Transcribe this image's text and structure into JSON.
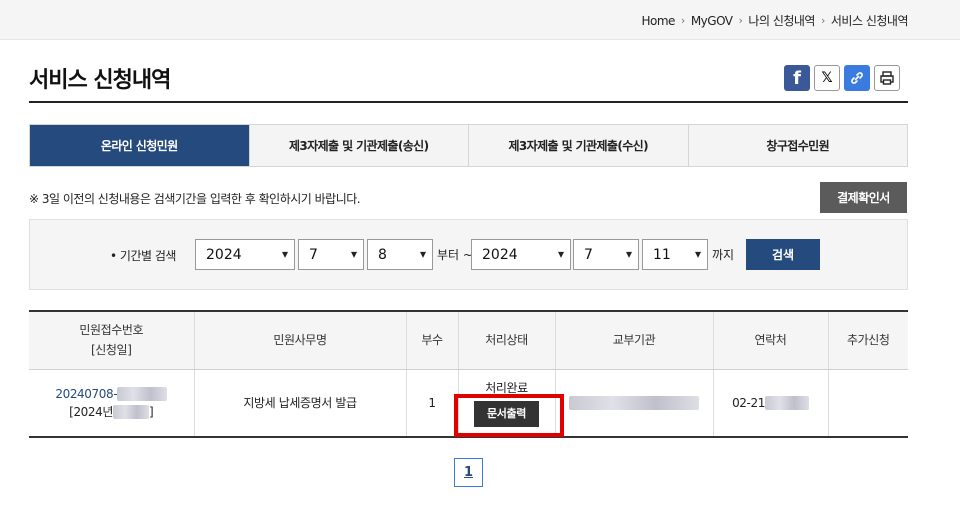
{
  "breadcrumb": [
    "Home",
    "MyGOV",
    "나의 신청내역",
    "서비스 신청내역"
  ],
  "page_title": "서비스 신청내역",
  "share_icons": [
    "facebook-icon",
    "x-icon",
    "link-icon",
    "print-icon"
  ],
  "tabs": [
    {
      "label": "온라인 신청민원",
      "active": true
    },
    {
      "label": "제3자제출 및 기관제출(송신)",
      "active": false
    },
    {
      "label": "제3자제출 및 기관제출(수신)",
      "active": false
    },
    {
      "label": "창구접수민원",
      "active": false
    }
  ],
  "notice": "※ 3일 이전의 신청내용은 검색기간을 입력한 후 확인하시기 바랍니다.",
  "confirm_button": "결제확인서",
  "search": {
    "label": "기간별 검색",
    "from_year": "2024",
    "from_month": "7",
    "from_day": "8",
    "from_suffix": "부터 ~",
    "to_year": "2024",
    "to_month": "7",
    "to_day": "11",
    "to_suffix": "까지",
    "button": "검색"
  },
  "table": {
    "headers": [
      "민원접수번호\n[신청일]",
      "민원사무명",
      "부수",
      "처리상태",
      "교부기관",
      "연락처",
      "추가신청"
    ],
    "header_line1": "민원접수번호",
    "header_line2": "[신청일]",
    "row": {
      "receipt_no": "20240708-",
      "date_prefix": "[2024년",
      "date_suffix": "]",
      "service": "지방세 납세증명서 발급",
      "copies": "1",
      "status": "처리완료",
      "print_button": "문서출력",
      "phone_prefix": "02-21"
    }
  },
  "pagination": {
    "current": "1"
  },
  "colors": {
    "primary": "#254a7e",
    "highlight": "#e10000"
  }
}
